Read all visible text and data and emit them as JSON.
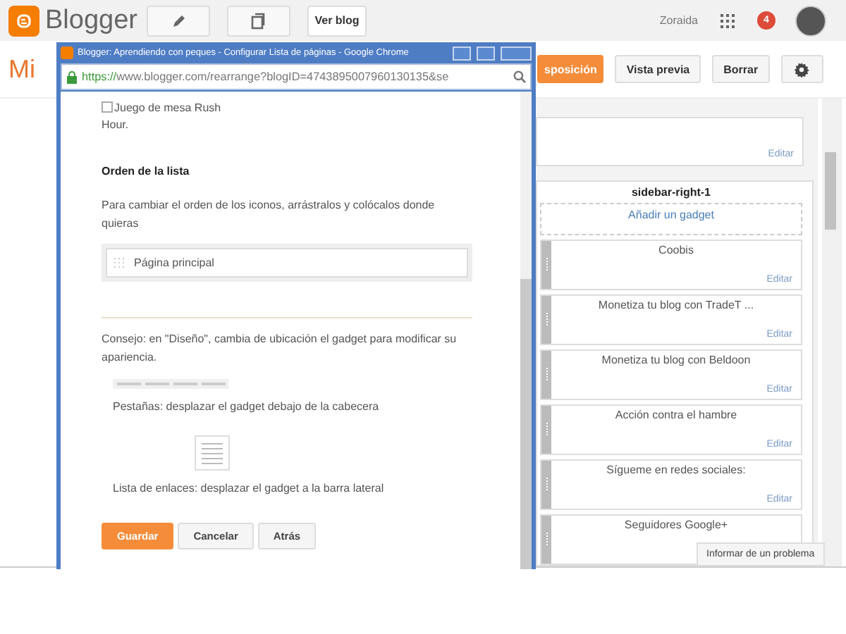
{
  "topbar": {
    "brand": "Blogger",
    "view_blog": "Ver blog",
    "user": "Zoraida",
    "notifications": "4"
  },
  "header": {
    "title": "Mi",
    "buttons": [
      {
        "label": "sposición",
        "kind": "primary"
      },
      {
        "label": "Vista previa",
        "kind": "default"
      },
      {
        "label": "Borrar",
        "kind": "default"
      }
    ]
  },
  "layout": {
    "top_gadget": {
      "edit": "Editar"
    },
    "section": {
      "title": "sidebar-right-1",
      "add": "Añadir un gadget",
      "gadgets": [
        {
          "title": "Coobis",
          "edit": "Editar"
        },
        {
          "title": "Monetiza tu blog con TradeT ...",
          "edit": "Editar"
        },
        {
          "title": "Monetiza tu blog con Beldoon",
          "edit": "Editar"
        },
        {
          "title": "Acción contra el hambre",
          "edit": "Editar"
        },
        {
          "title": "Sígueme en redes sociales:",
          "edit": "Editar"
        },
        {
          "title": "Seguidores Google+"
        }
      ]
    }
  },
  "report": "Informar de un problema",
  "popup": {
    "title": "Blogger: Aprendiendo con peques - Configurar Lista de páginas - Google Chrome",
    "url_scheme": "https://",
    "url_rest": "www.blogger.com/rearrange?blogID=4743895007960130135&se",
    "pages": [
      {
        "label": "Juego de mesa Rush Hour.",
        "checked": false
      }
    ],
    "order_heading": "Orden de la lista",
    "order_hint": "Para cambiar el orden de los iconos, arrástralos y colócalos donde quieras",
    "order_items": [
      "Página principal"
    ],
    "tip": "Consejo: en \"Diseño\", cambia de ubicación el gadget para modificar su apariencia.",
    "tabs_caption": "Pestañas: desplazar el gadget debajo de la cabecera",
    "list_caption": "Lista de enlaces: desplazar el gadget a la barra lateral",
    "buttons": [
      {
        "label": "Guardar",
        "kind": "primary"
      },
      {
        "label": "Cancelar",
        "kind": "default"
      },
      {
        "label": "Atrás",
        "kind": "default"
      }
    ]
  }
}
